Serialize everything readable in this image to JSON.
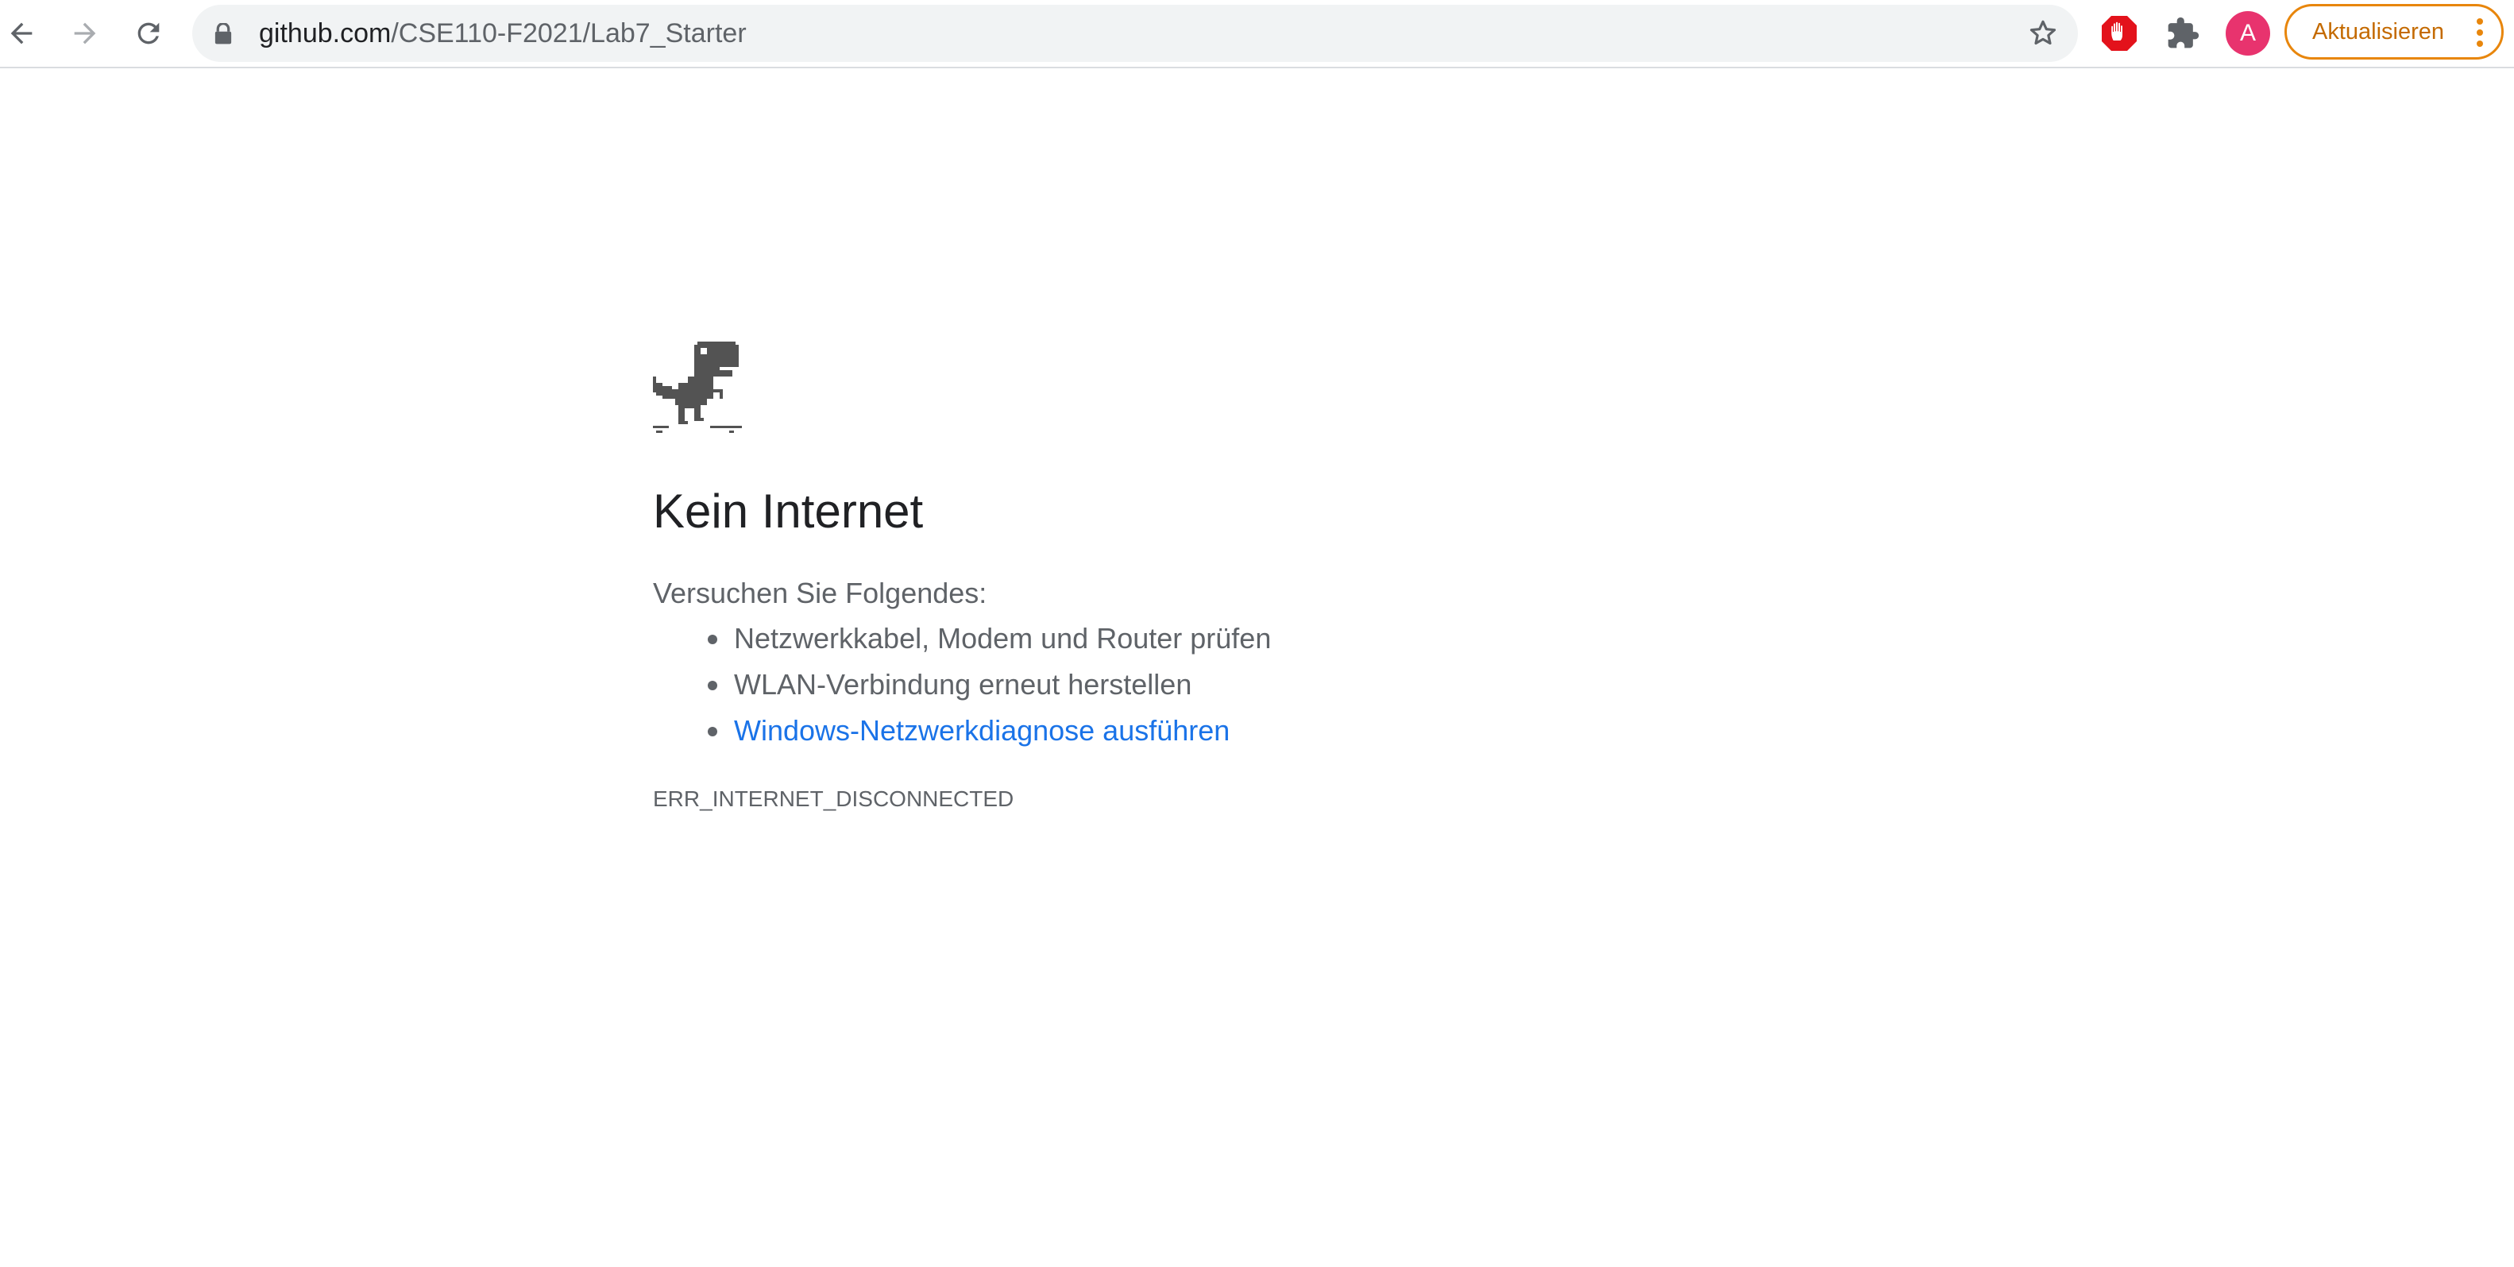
{
  "browser": {
    "url_host": "github.com",
    "url_path": "/CSE110-F2021/Lab7_Starter",
    "avatar_initial": "A",
    "update_label": "Aktualisieren",
    "icons": {
      "back": "arrow-left",
      "forward": "arrow-right",
      "reload": "reload",
      "lock": "lock",
      "bookmark": "star-outline",
      "adblock": "red-stop-hand",
      "extensions": "puzzle-piece",
      "menu": "vertical-dots"
    },
    "colors": {
      "avatar": "#e8336e",
      "update_accent": "#e8860c",
      "adblock": "#e3121b"
    }
  },
  "error_page": {
    "illustration": "offline-dinosaur",
    "heading": "Kein Internet",
    "intro": "Versuchen Sie Folgendes:",
    "suggestions": [
      "Netzwerkkabel, Modem und Router prüfen",
      "WLAN-Verbindung erneut herstellen",
      "Windows-Netzwerkdiagnose ausführen"
    ],
    "error_code": "ERR_INTERNET_DISCONNECTED",
    "link_color": "#1a73e8"
  }
}
